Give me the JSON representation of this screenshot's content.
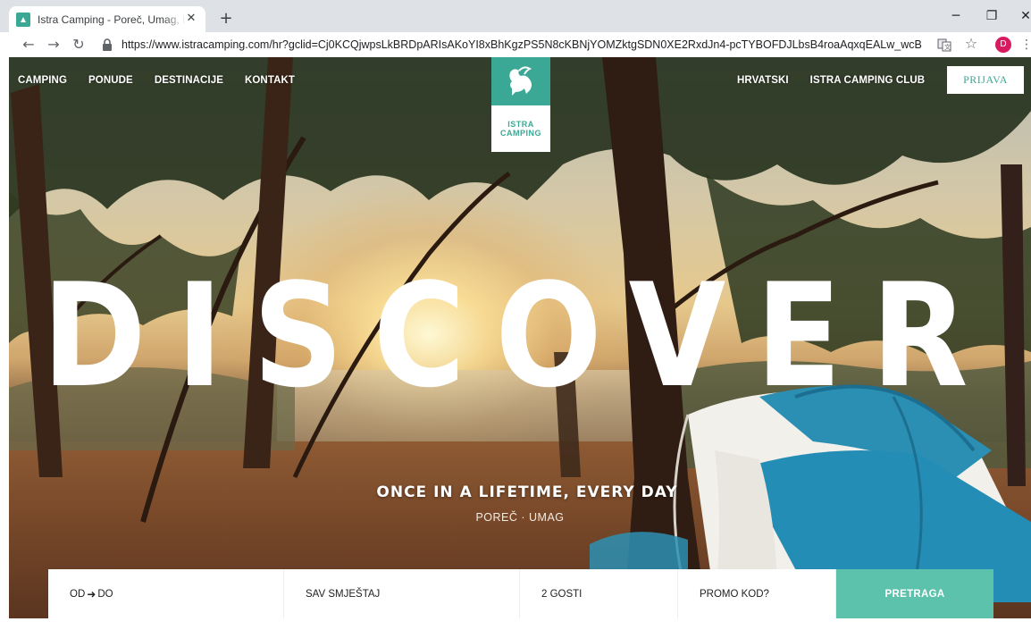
{
  "browser": {
    "tab_title": "Istra Camping - Poreč, Umag, Istra",
    "tab_close_glyph": "✕",
    "new_tab_glyph": "+",
    "url": "https://www.istracamping.com/hr?gclid=Cj0KCQjwpsLkBRDpARIsAKoYI8xBhKgzPS5N8cKBNjYOMZktgSDN0XE2RxdJn4-pcTYBOFDJLbsB4roaAqxqEALw_wcB",
    "profile_initial": "D",
    "icons": [
      "back-arrow-icon",
      "forward-arrow-icon",
      "reload-icon",
      "lock-icon",
      "translate-icon",
      "star-icon",
      "profile-avatar",
      "menu-icon",
      "minimize-icon",
      "restore-icon",
      "close-icon"
    ]
  },
  "site": {
    "nav": [
      "CAMPING",
      "PONUDE",
      "DESTINACIJE",
      "KONTAKT"
    ],
    "language_link": "HRVATSKI",
    "club_link": "ISTRA CAMPING CLUB",
    "login_label": "PRIJAVA",
    "logo_line1": "ISTRA",
    "logo_line2": "CAMPING",
    "hero_word": "DISCOVER",
    "tagline": "ONCE IN A LIFETIME, EVERY DAY",
    "locations": "POREČ · UMAG",
    "booking": {
      "dates_from": "OD",
      "dates_to": "DO",
      "accommodation": "SAV SMJEŠTAJ",
      "guests": "2 GOSTI",
      "promo": "PROMO KOD?",
      "search": "PRETRAGA"
    }
  },
  "colors": {
    "brand_teal": "#3aa894",
    "search_teal": "#5cc2ac",
    "tent_blue": "#2b8fb3"
  }
}
